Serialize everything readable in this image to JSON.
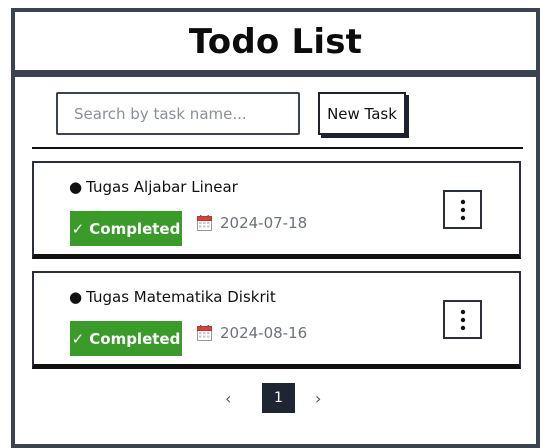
{
  "app": {
    "title": "Todo List"
  },
  "toolbar": {
    "search_placeholder": "Search by task name...",
    "search_value": "",
    "new_task_label": "New Task"
  },
  "tasks": [
    {
      "name": "Tugas Aljabar Linear",
      "status": "Completed",
      "due_date": "2024-07-18"
    },
    {
      "name": "Tugas Matematika Diskrit",
      "status": "Completed",
      "due_date": "2024-08-16"
    }
  ],
  "pagination": {
    "current_page": "1",
    "prev_icon": "chevron-left-icon",
    "next_icon": "chevron-right-icon"
  },
  "icons": {
    "status": "check-icon",
    "date": "calendar-icon",
    "menu": "kebab-menu-icon"
  },
  "colors": {
    "completed": "#3a9a2a",
    "frame": "#3b4250",
    "active_page": "#1f2633"
  }
}
